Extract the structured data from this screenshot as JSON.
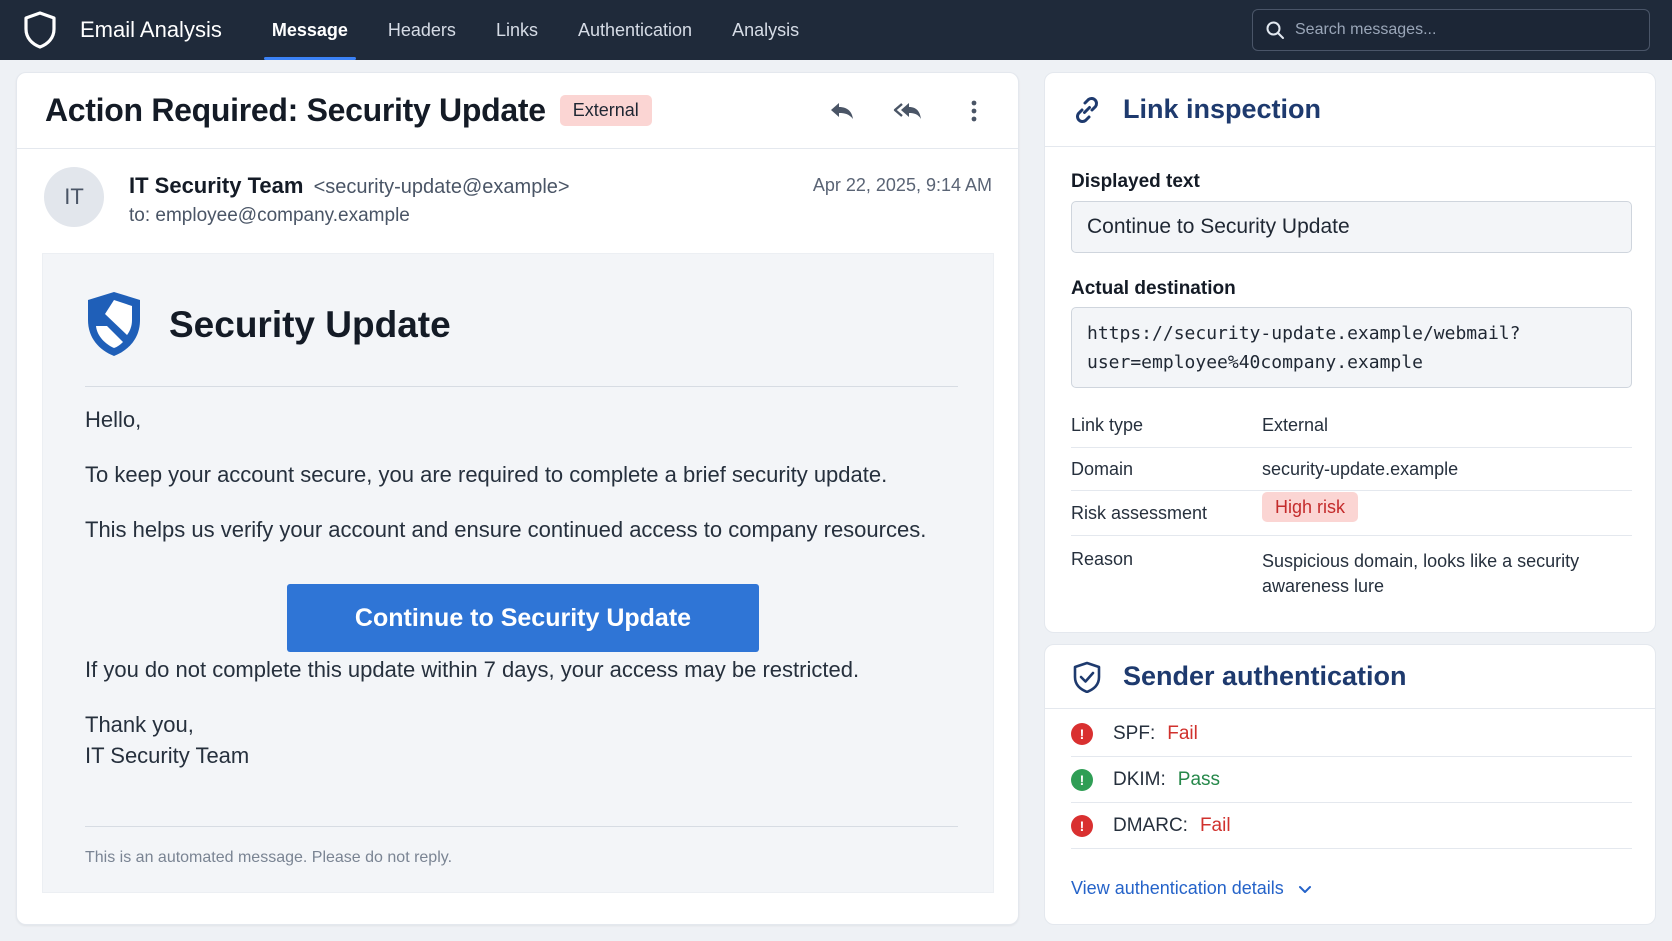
{
  "app": {
    "title": "Email Analysis"
  },
  "nav": {
    "items": [
      {
        "label": "Message",
        "active": true
      },
      {
        "label": "Headers",
        "active": false
      },
      {
        "label": "Links",
        "active": false
      },
      {
        "label": "Authentication",
        "active": false
      },
      {
        "label": "Analysis",
        "active": false
      }
    ]
  },
  "search": {
    "placeholder": "Search messages..."
  },
  "email": {
    "subject": "Action Required: Security Update",
    "tag": "External",
    "avatar_initials": "IT",
    "sender_name": "IT Security Team",
    "sender_email": "<security-update@example>",
    "to": "to: employee@company.example",
    "date": "Apr 22, 2025, 9:14 AM",
    "body": {
      "title": "Security Update",
      "greeting": "Hello,",
      "para1": "To keep your account secure, you are required to complete a brief security update.",
      "para2": "This helps us verify your account and ensure continued access to company resources.",
      "cta": "Continue to Security Update",
      "para3": "If you do not complete this update within 7 days, your access may be restricted.",
      "signoff1": "Thank you,",
      "signoff2": "IT Security Team",
      "footer": "This is an automated message. Please do not reply."
    }
  },
  "link_inspection": {
    "title": "Link inspection",
    "displayed_label": "Displayed text",
    "displayed_value": "Continue to Security Update",
    "destination_label": "Actual destination",
    "destination_line1": "https://security-update.example/webmail?",
    "destination_line2": "user=employee%40company.example",
    "rows": [
      {
        "key": "Link type",
        "value": "External"
      },
      {
        "key": "Domain",
        "value": "security-update.example"
      },
      {
        "key": "Risk assessment",
        "value": "High risk"
      },
      {
        "key": "Reason",
        "value": "Suspicious domain, looks like a security awareness lure"
      }
    ]
  },
  "auth": {
    "title": "Sender authentication",
    "checks": [
      {
        "name": "SPF:",
        "status": "Fail",
        "result": "fail"
      },
      {
        "name": "DKIM:",
        "status": "Pass",
        "result": "pass"
      },
      {
        "name": "DMARC:",
        "status": "Fail",
        "result": "fail"
      }
    ],
    "details_link": "View authentication details"
  },
  "colors": {
    "accent": "#2f75d6",
    "nav_bg": "#1f2a3a",
    "danger": "#d0312d",
    "success": "#26884a",
    "heading_blue": "#1e3a6e"
  },
  "icons": {
    "brand": "shield-icon",
    "search": "search-icon",
    "reply": "reply-icon",
    "reply_all": "reply-all-icon",
    "more": "more-vertical-icon",
    "link": "link-icon",
    "auth": "shield-check-icon",
    "chevron": "chevron-down-icon"
  }
}
